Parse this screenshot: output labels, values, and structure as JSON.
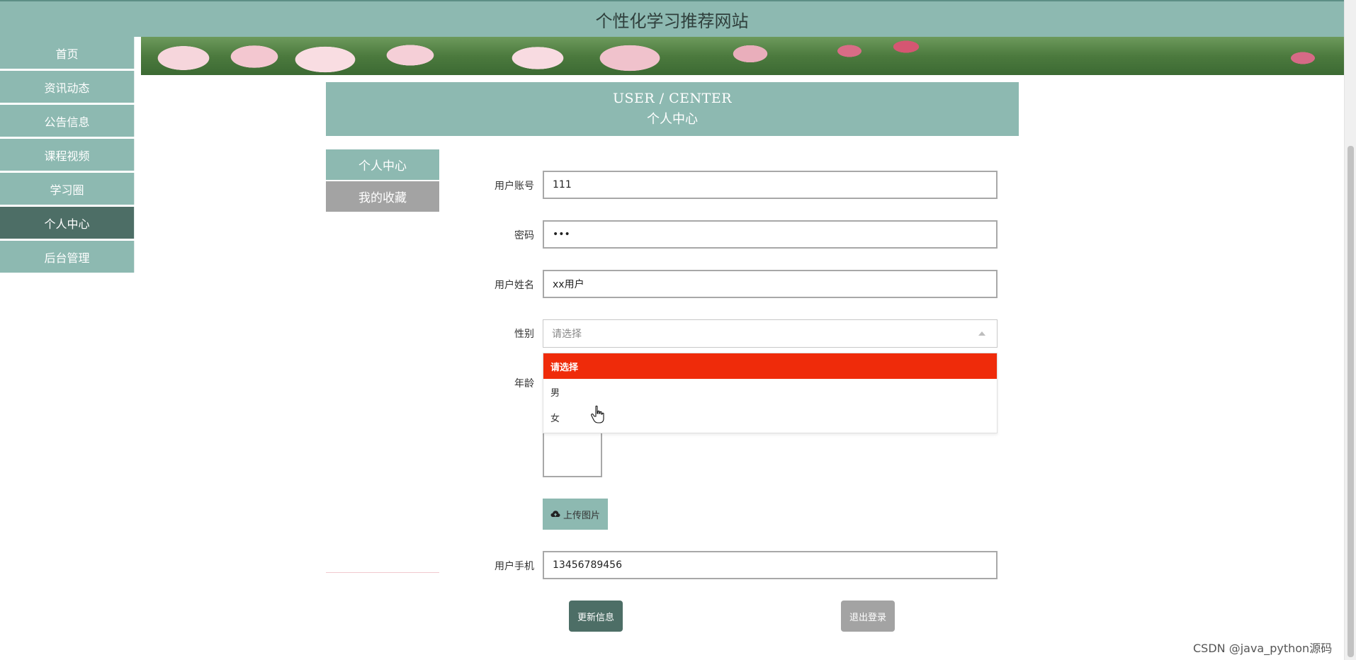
{
  "site": {
    "title": "个性化学习推荐网站"
  },
  "sidebar": {
    "items": [
      {
        "label": "首页"
      },
      {
        "label": "资讯动态"
      },
      {
        "label": "公告信息"
      },
      {
        "label": "课程视频"
      },
      {
        "label": "学习圈"
      },
      {
        "label": "个人中心",
        "active": true
      },
      {
        "label": "后台管理"
      }
    ]
  },
  "section": {
    "title_en": "USER / CENTER",
    "title_cn": "个人中心"
  },
  "inner_tabs": [
    {
      "label": "个人中心",
      "active": true
    },
    {
      "label": "我的收藏"
    }
  ],
  "form": {
    "account": {
      "label": "用户账号",
      "value": "111"
    },
    "password": {
      "label": "密码",
      "value": "•••"
    },
    "name": {
      "label": "用户姓名",
      "value": "xx用户"
    },
    "gender": {
      "label": "性别",
      "placeholder": "请选择",
      "options": [
        "请选择",
        "男",
        "女"
      ],
      "highlighted": "请选择"
    },
    "age": {
      "label": "年龄"
    },
    "upload": {
      "label": "上传图片"
    },
    "phone": {
      "label": "用户手机",
      "value": "13456789456"
    }
  },
  "buttons": {
    "update": "更新信息",
    "logout": "退出登录"
  },
  "watermark": "CSDN @java_python源码",
  "colors": {
    "primary": "#8db9b1",
    "dark": "#4d6e66",
    "gray": "#a3a3a3",
    "highlight": "#ef2b0a"
  }
}
